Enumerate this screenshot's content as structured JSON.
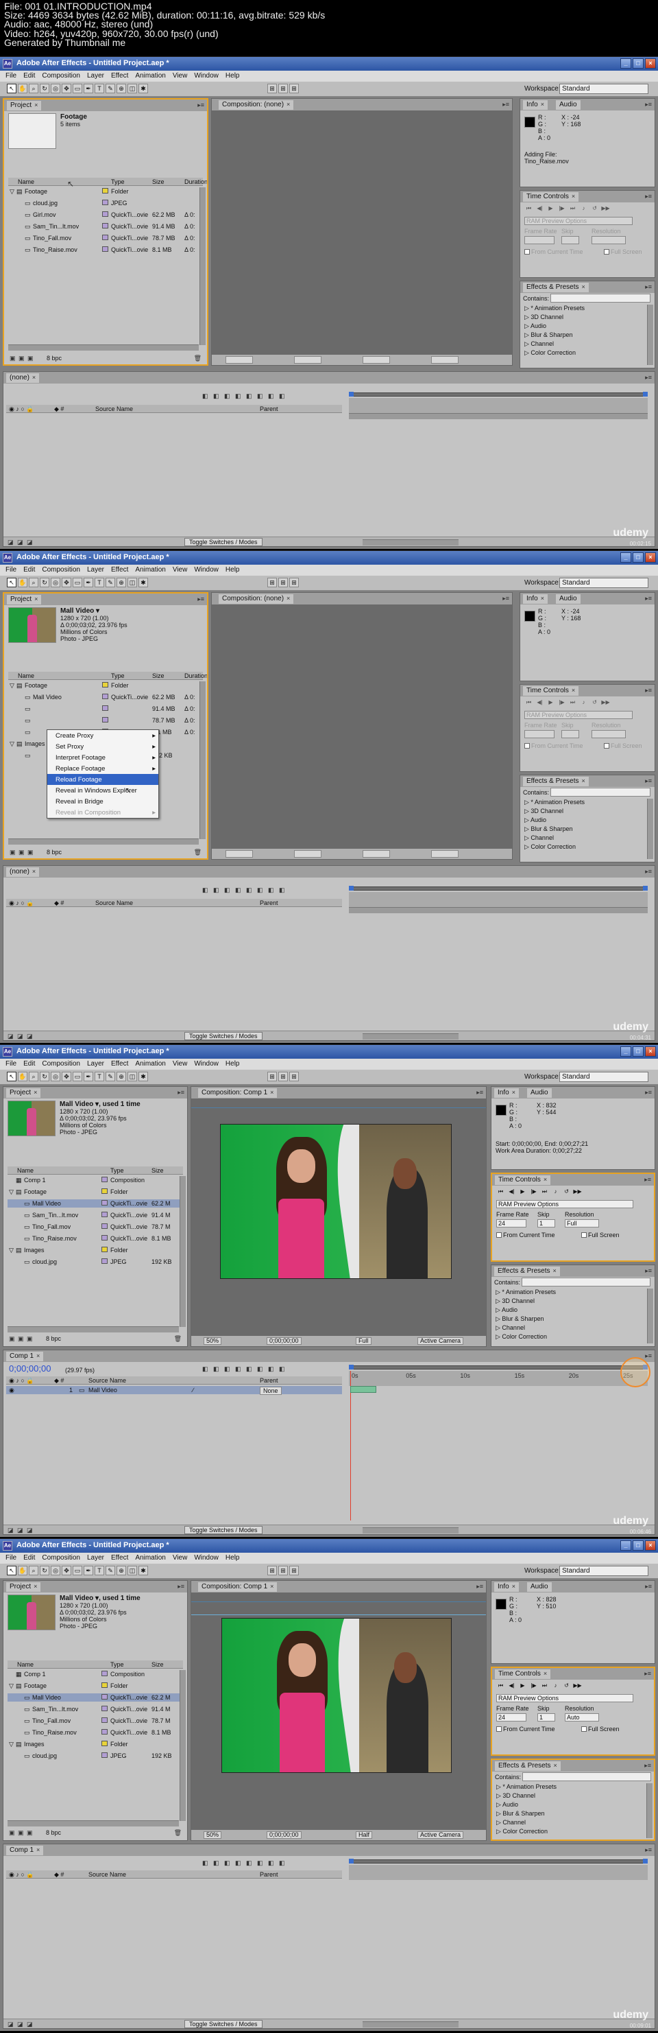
{
  "header": {
    "lines": [
      "File: 001 01.INTRODUCTION.mp4",
      "Size: 4469 3634 bytes (42.62 MiB), duration: 00:11:16, avg.bitrate: 529 kb/s",
      "Audio: aac, 48000 Hz, stereo (und)",
      "Video: h264, yuv420p, 960x720, 30.00 fps(r) (und)",
      "Generated by Thumbnail me"
    ]
  },
  "app": {
    "title": "Adobe After Effects - Untitled Project.aep *",
    "menu": [
      "File",
      "Edit",
      "Composition",
      "Layer",
      "Effect",
      "Animation",
      "View",
      "Window",
      "Help"
    ],
    "workspace_label": "Workspace:",
    "workspace_value": "Standard",
    "bpc": "8 bpc",
    "toggle_label": "Toggle Switches / Modes",
    "watermark": "udemy",
    "columns": {
      "name": "Name",
      "type": "Type",
      "size": "Size",
      "duration": "Duration",
      "source_name": "Source Name",
      "parent": "Parent"
    },
    "tabs": {
      "project": "Project",
      "info": "Info",
      "audio": "Audio",
      "time_controls": "Time Controls",
      "effects": "Effects & Presets",
      "composition_none": "Composition: (none)",
      "composition_comp1": "Composition: Comp 1",
      "timeline_none": "(none)",
      "timeline_comp1": "Comp 1"
    },
    "effects": {
      "contains_label": "Contains:",
      "items": [
        "* Animation Presets",
        "3D Channel",
        "Audio",
        "Blur & Sharpen",
        "Channel",
        "Color Correction"
      ]
    },
    "time_controls": {
      "ram_preview": "RAM Preview Options",
      "frame_rate_label": "Frame Rate",
      "skip_label": "Skip",
      "resolution_label": "Resolution",
      "frame_rate_value": "24",
      "skip_value": "1",
      "from_current": "From Current Time",
      "full_screen": "Full Screen"
    }
  },
  "frames": [
    {
      "stamp": "00:02:15",
      "thumb_title": "Footage",
      "thumb_sub": "5 items",
      "files": [
        {
          "name": "Footage",
          "type": "Folder",
          "size": "",
          "dur": "",
          "kind": "folder"
        },
        {
          "name": "cloud.jpg",
          "type": "JPEG",
          "size": "",
          "dur": "",
          "kind": "file"
        },
        {
          "name": "Girl.mov",
          "type": "QuickTi...ovie",
          "size": "62.2 MB",
          "dur": "Δ 0:",
          "kind": "file"
        },
        {
          "name": "Sam_Tin...lt.mov",
          "type": "QuickTi...ovie",
          "size": "91.4 MB",
          "dur": "Δ 0:",
          "kind": "file"
        },
        {
          "name": "Tino_Fall.mov",
          "type": "QuickTi...ovie",
          "size": "78.7 MB",
          "dur": "Δ 0:",
          "kind": "file"
        },
        {
          "name": "Tino_Raise.mov",
          "type": "QuickTi...ovie",
          "size": "8.1 MB",
          "dur": "Δ 0:",
          "kind": "file"
        }
      ],
      "info_x": "X : -24",
      "info_y": "Y : 168",
      "adding_file": "Adding File:",
      "adding_name": "Tino_Raise.mov"
    },
    {
      "stamp": "00:04:31",
      "thumb_title": "Mall Video ▾",
      "thumb_lines": [
        "1280 x 720 (1.00)",
        "Δ 0;00;03;02, 23.976 fps",
        "Millions of Colors",
        "Photo - JPEG"
      ],
      "files": [
        {
          "name": "Footage",
          "type": "Folder",
          "size": "",
          "dur": "",
          "kind": "folder"
        },
        {
          "name": "Mall Video",
          "type": "QuickTi...ovie",
          "size": "62.2 MB",
          "dur": "Δ 0:",
          "kind": "file"
        },
        {
          "name": "",
          "type": "",
          "size": "91.4 MB",
          "dur": "Δ 0:",
          "kind": "file"
        },
        {
          "name": "",
          "type": "",
          "size": "78.7 MB",
          "dur": "Δ 0:",
          "kind": "file"
        },
        {
          "name": "",
          "type": "",
          "size": "8.1 MB",
          "dur": "Δ 0:",
          "kind": "file"
        },
        {
          "name": "Images",
          "type": "",
          "size": "",
          "dur": "",
          "kind": "folder"
        },
        {
          "name": "",
          "type": "",
          "size": "192 KB",
          "dur": "",
          "kind": "file"
        }
      ],
      "context_menu": [
        {
          "label": "Create Proxy",
          "sub": true,
          "state": ""
        },
        {
          "label": "Set Proxy",
          "sub": true,
          "state": ""
        },
        {
          "label": "Interpret Footage",
          "sub": true,
          "state": ""
        },
        {
          "label": "Replace Footage",
          "sub": true,
          "state": ""
        },
        {
          "label": "Reload Footage",
          "sub": false,
          "state": "hl"
        },
        {
          "label": "Reveal in Windows Explorer",
          "sub": false,
          "state": ""
        },
        {
          "label": "Reveal in Bridge",
          "sub": false,
          "state": ""
        },
        {
          "label": "Reveal in Composition",
          "sub": true,
          "state": "dis"
        }
      ],
      "info_x": "X : -24",
      "info_y": "Y : 168"
    },
    {
      "stamp": "00:06:46",
      "thumb_title": "Mall Video ▾, used 1 time",
      "thumb_lines": [
        "1280 x 720 (1.00)",
        "Δ 0;00;03;02, 23.976 fps",
        "Millions of Colors",
        "Photo - JPEG"
      ],
      "files": [
        {
          "name": "Comp 1",
          "type": "Composition",
          "size": "",
          "kind": "comp"
        },
        {
          "name": "Footage",
          "type": "Folder",
          "size": "",
          "kind": "folder"
        },
        {
          "name": "Mall Video",
          "type": "QuickTi...ovie",
          "size": "62.2 M",
          "kind": "file",
          "sel": true
        },
        {
          "name": "Sam_Tin...lt.mov",
          "type": "QuickTi...ovie",
          "size": "91.4 M",
          "kind": "file"
        },
        {
          "name": "Tino_Fall.mov",
          "type": "QuickTi...ovie",
          "size": "78.7 M",
          "kind": "file"
        },
        {
          "name": "Tino_Raise.mov",
          "type": "QuickTi...ovie",
          "size": "8.1 MB",
          "kind": "file"
        },
        {
          "name": "Images",
          "type": "Folder",
          "size": "",
          "kind": "folder"
        },
        {
          "name": "cloud.jpg",
          "type": "JPEG",
          "size": "192 KB",
          "kind": "file"
        }
      ],
      "info_x": "X : 832",
      "info_y": "Y : 544",
      "info_start": "Start: 0;00;00;00, End: 0;00;27;21",
      "info_work": "Work Area Duration: 0;00;27;22",
      "zoom": "50%",
      "timecode": "0;00;00;00",
      "res": "Full",
      "camera": "Active Camera",
      "tl_timecode": "0;00;00;00",
      "tl_fps": "(29.97 fps)",
      "tl_ticks": [
        "0s",
        "05s",
        "10s",
        "15s",
        "20s",
        "25s"
      ],
      "layer_num": "1",
      "layer_name": "Mall Video",
      "parent_value": "None"
    },
    {
      "stamp": "00:09:01",
      "thumb_title": "Mall Video ▾, used 1 time",
      "thumb_lines": [
        "1280 x 720 (1.00)",
        "Δ 0;00;03;02, 23.976 fps",
        "Millions of Colors",
        "Photo - JPEG"
      ],
      "files": [
        {
          "name": "Comp 1",
          "type": "Composition",
          "size": "",
          "kind": "comp"
        },
        {
          "name": "Footage",
          "type": "Folder",
          "size": "",
          "kind": "folder"
        },
        {
          "name": "Mall Video",
          "type": "QuickTi...ovie",
          "size": "62.2 M",
          "kind": "file",
          "sel": true
        },
        {
          "name": "Sam_Tin...lt.mov",
          "type": "QuickTi...ovie",
          "size": "91.4 M",
          "kind": "file"
        },
        {
          "name": "Tino_Fall.mov",
          "type": "QuickTi...ovie",
          "size": "78.7 M",
          "kind": "file"
        },
        {
          "name": "Tino_Raise.mov",
          "type": "QuickTi...ovie",
          "size": "8.1 MB",
          "kind": "file"
        },
        {
          "name": "Images",
          "type": "Folder",
          "size": "",
          "kind": "folder"
        },
        {
          "name": "cloud.jpg",
          "type": "JPEG",
          "size": "192 KB",
          "kind": "file"
        }
      ],
      "info_x": "X : 828",
      "info_y": "Y : 510",
      "zoom": "50%",
      "timecode": "0;00;00;00",
      "res": "Half",
      "camera": "Active Camera",
      "resolution_value": "Auto"
    }
  ]
}
